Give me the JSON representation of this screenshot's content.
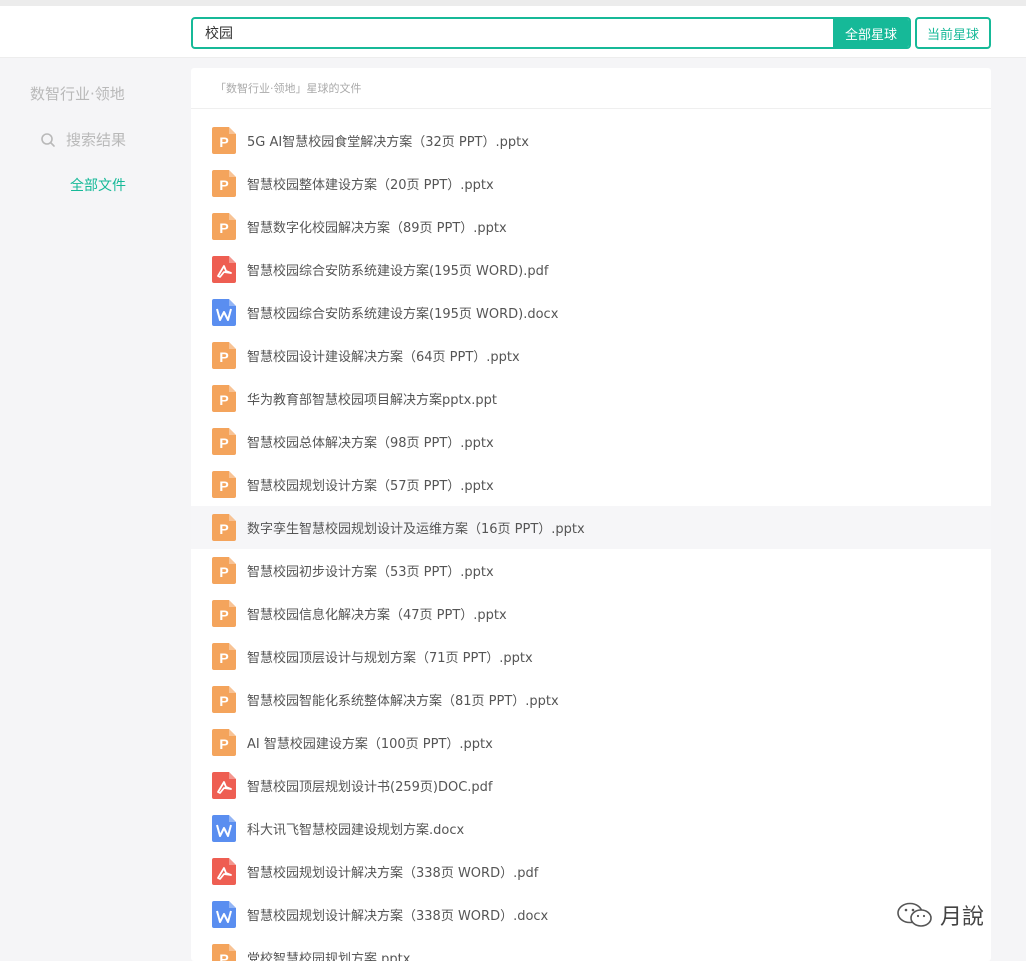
{
  "search": {
    "query": "校园",
    "all_planets_label": "全部星球",
    "current_planet_label": "当前星球"
  },
  "sidebar": {
    "title": "数智行业·领地",
    "search_results_label": "搜索结果",
    "all_files_label": "全部文件"
  },
  "panel": {
    "header": "「数智行业·领地」星球的文件"
  },
  "colors": {
    "accent": "#16b998",
    "ppt": "#f4a45c",
    "pdf": "#ee5e52",
    "word": "#5a8ef0"
  },
  "files": [
    {
      "name": "5G AI智慧校园食堂解决方案（32页 PPT）.pptx",
      "icon": "ppt-file-icon"
    },
    {
      "name": "智慧校园整体建设方案（20页 PPT）.pptx",
      "icon": "ppt-file-icon"
    },
    {
      "name": "智慧数字化校园解决方案（89页 PPT）.pptx",
      "icon": "ppt-file-icon"
    },
    {
      "name": "智慧校园综合安防系统建设方案(195页 WORD).pdf",
      "icon": "pdf-file-icon"
    },
    {
      "name": "智慧校园综合安防系统建设方案(195页 WORD).docx",
      "icon": "word-file-icon"
    },
    {
      "name": "智慧校园设计建设解决方案（64页 PPT）.pptx",
      "icon": "ppt-file-icon"
    },
    {
      "name": "华为教育部智慧校园项目解决方案pptx.ppt",
      "icon": "ppt-file-icon"
    },
    {
      "name": "智慧校园总体解决方案（98页 PPT）.pptx",
      "icon": "ppt-file-icon"
    },
    {
      "name": "智慧校园规划设计方案（57页 PPT）.pptx",
      "icon": "ppt-file-icon"
    },
    {
      "name": "数字孪生智慧校园规划设计及运维方案（16页 PPT）.pptx",
      "icon": "ppt-file-icon"
    },
    {
      "name": "智慧校园初步设计方案（53页 PPT）.pptx",
      "icon": "ppt-file-icon"
    },
    {
      "name": "智慧校园信息化解决方案（47页 PPT）.pptx",
      "icon": "ppt-file-icon"
    },
    {
      "name": "智慧校园顶层设计与规划方案（71页 PPT）.pptx",
      "icon": "ppt-file-icon"
    },
    {
      "name": "智慧校园智能化系统整体解决方案（81页 PPT）.pptx",
      "icon": "ppt-file-icon"
    },
    {
      "name": "AI 智慧校园建设方案（100页 PPT）.pptx",
      "icon": "ppt-file-icon"
    },
    {
      "name": "智慧校园顶层规划设计书(259页)DOC.pdf",
      "icon": "pdf-file-icon"
    },
    {
      "name": "科大讯飞智慧校园建设规划方案.docx",
      "icon": "word-file-icon"
    },
    {
      "name": "智慧校园规划设计解决方案（338页 WORD）.pdf",
      "icon": "pdf-file-icon"
    },
    {
      "name": "智慧校园规划设计解决方案（338页 WORD）.docx",
      "icon": "word-file-icon"
    },
    {
      "name": "党校智慧校园规划方案.pptx",
      "icon": "ppt-file-icon"
    }
  ],
  "watermark": {
    "text": "月說"
  }
}
